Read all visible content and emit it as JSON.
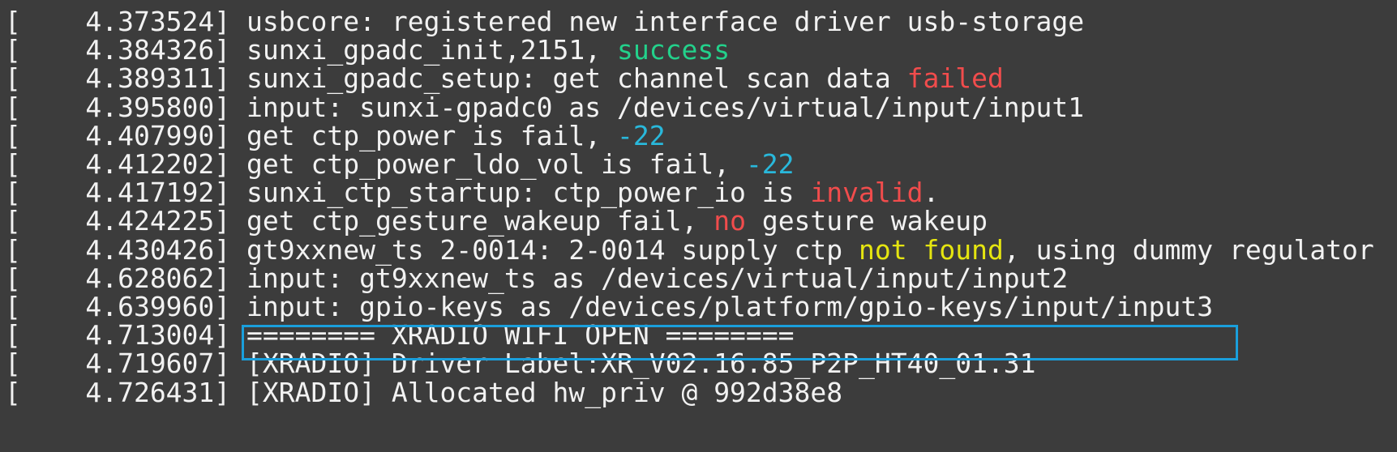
{
  "accent": {
    "highlight_border": "#1a9fdc",
    "background": "#3c3c3c"
  },
  "colors": {
    "green": "#23d18b",
    "red": "#f14c4c",
    "cyan": "#29b8db",
    "yellow": "#e5e510",
    "default": "#f2f2f2"
  },
  "log": {
    "lines": [
      {
        "ts": "4.373524",
        "segments": [
          {
            "t": "usbcore: registered new interface driver usb-storage",
            "c": ""
          }
        ]
      },
      {
        "ts": "4.384326",
        "segments": [
          {
            "t": "sunxi_gpadc_init,2151, ",
            "c": ""
          },
          {
            "t": "success",
            "c": "green"
          }
        ]
      },
      {
        "ts": "4.389311",
        "segments": [
          {
            "t": "sunxi_gpadc_setup: get channel scan data ",
            "c": ""
          },
          {
            "t": "failed",
            "c": "red"
          }
        ]
      },
      {
        "ts": "4.395800",
        "segments": [
          {
            "t": "input: sunxi-gpadc0 as /devices/virtual/input/input1",
            "c": ""
          }
        ]
      },
      {
        "ts": "4.407990",
        "segments": [
          {
            "t": "get ctp_power is fail, ",
            "c": ""
          },
          {
            "t": "-22",
            "c": "cyan"
          }
        ]
      },
      {
        "ts": "4.412202",
        "segments": [
          {
            "t": "get ctp_power_ldo_vol is fail, ",
            "c": ""
          },
          {
            "t": "-22",
            "c": "cyan"
          }
        ]
      },
      {
        "ts": "4.417192",
        "segments": [
          {
            "t": "sunxi_ctp_startup: ctp_power_io is ",
            "c": ""
          },
          {
            "t": "invalid",
            "c": "red"
          },
          {
            "t": ".",
            "c": ""
          }
        ]
      },
      {
        "ts": "4.424225",
        "segments": [
          {
            "t": "get ctp_gesture_wakeup fail, ",
            "c": ""
          },
          {
            "t": "no",
            "c": "red"
          },
          {
            "t": " gesture wakeup",
            "c": ""
          }
        ]
      },
      {
        "ts": "4.430426",
        "segments": [
          {
            "t": "gt9xxnew_ts 2-0014: 2-0014 supply ctp ",
            "c": ""
          },
          {
            "t": "not found",
            "c": "yellow"
          },
          {
            "t": ", using dummy regulator",
            "c": ""
          }
        ]
      },
      {
        "ts": "4.628062",
        "segments": [
          {
            "t": "input: gt9xxnew_ts as /devices/virtual/input/input2",
            "c": ""
          }
        ]
      },
      {
        "ts": "4.639960",
        "segments": [
          {
            "t": "input: gpio-keys as /devices/platform/gpio-keys/input/input3",
            "c": ""
          }
        ],
        "highlighted": true
      },
      {
        "ts": "4.713004",
        "segments": [
          {
            "t": "======== XRADIO WIFI OPEN ========",
            "c": ""
          }
        ]
      },
      {
        "ts": "4.719607",
        "segments": [
          {
            "t": "[XRADIO] Driver Label:XR_V02.16.85_P2P_HT40_01.31",
            "c": ""
          }
        ]
      },
      {
        "ts": "4.726431",
        "segments": [
          {
            "t": "[XRADIO] Allocated hw_priv @ 992d38e8",
            "c": ""
          }
        ]
      }
    ]
  }
}
